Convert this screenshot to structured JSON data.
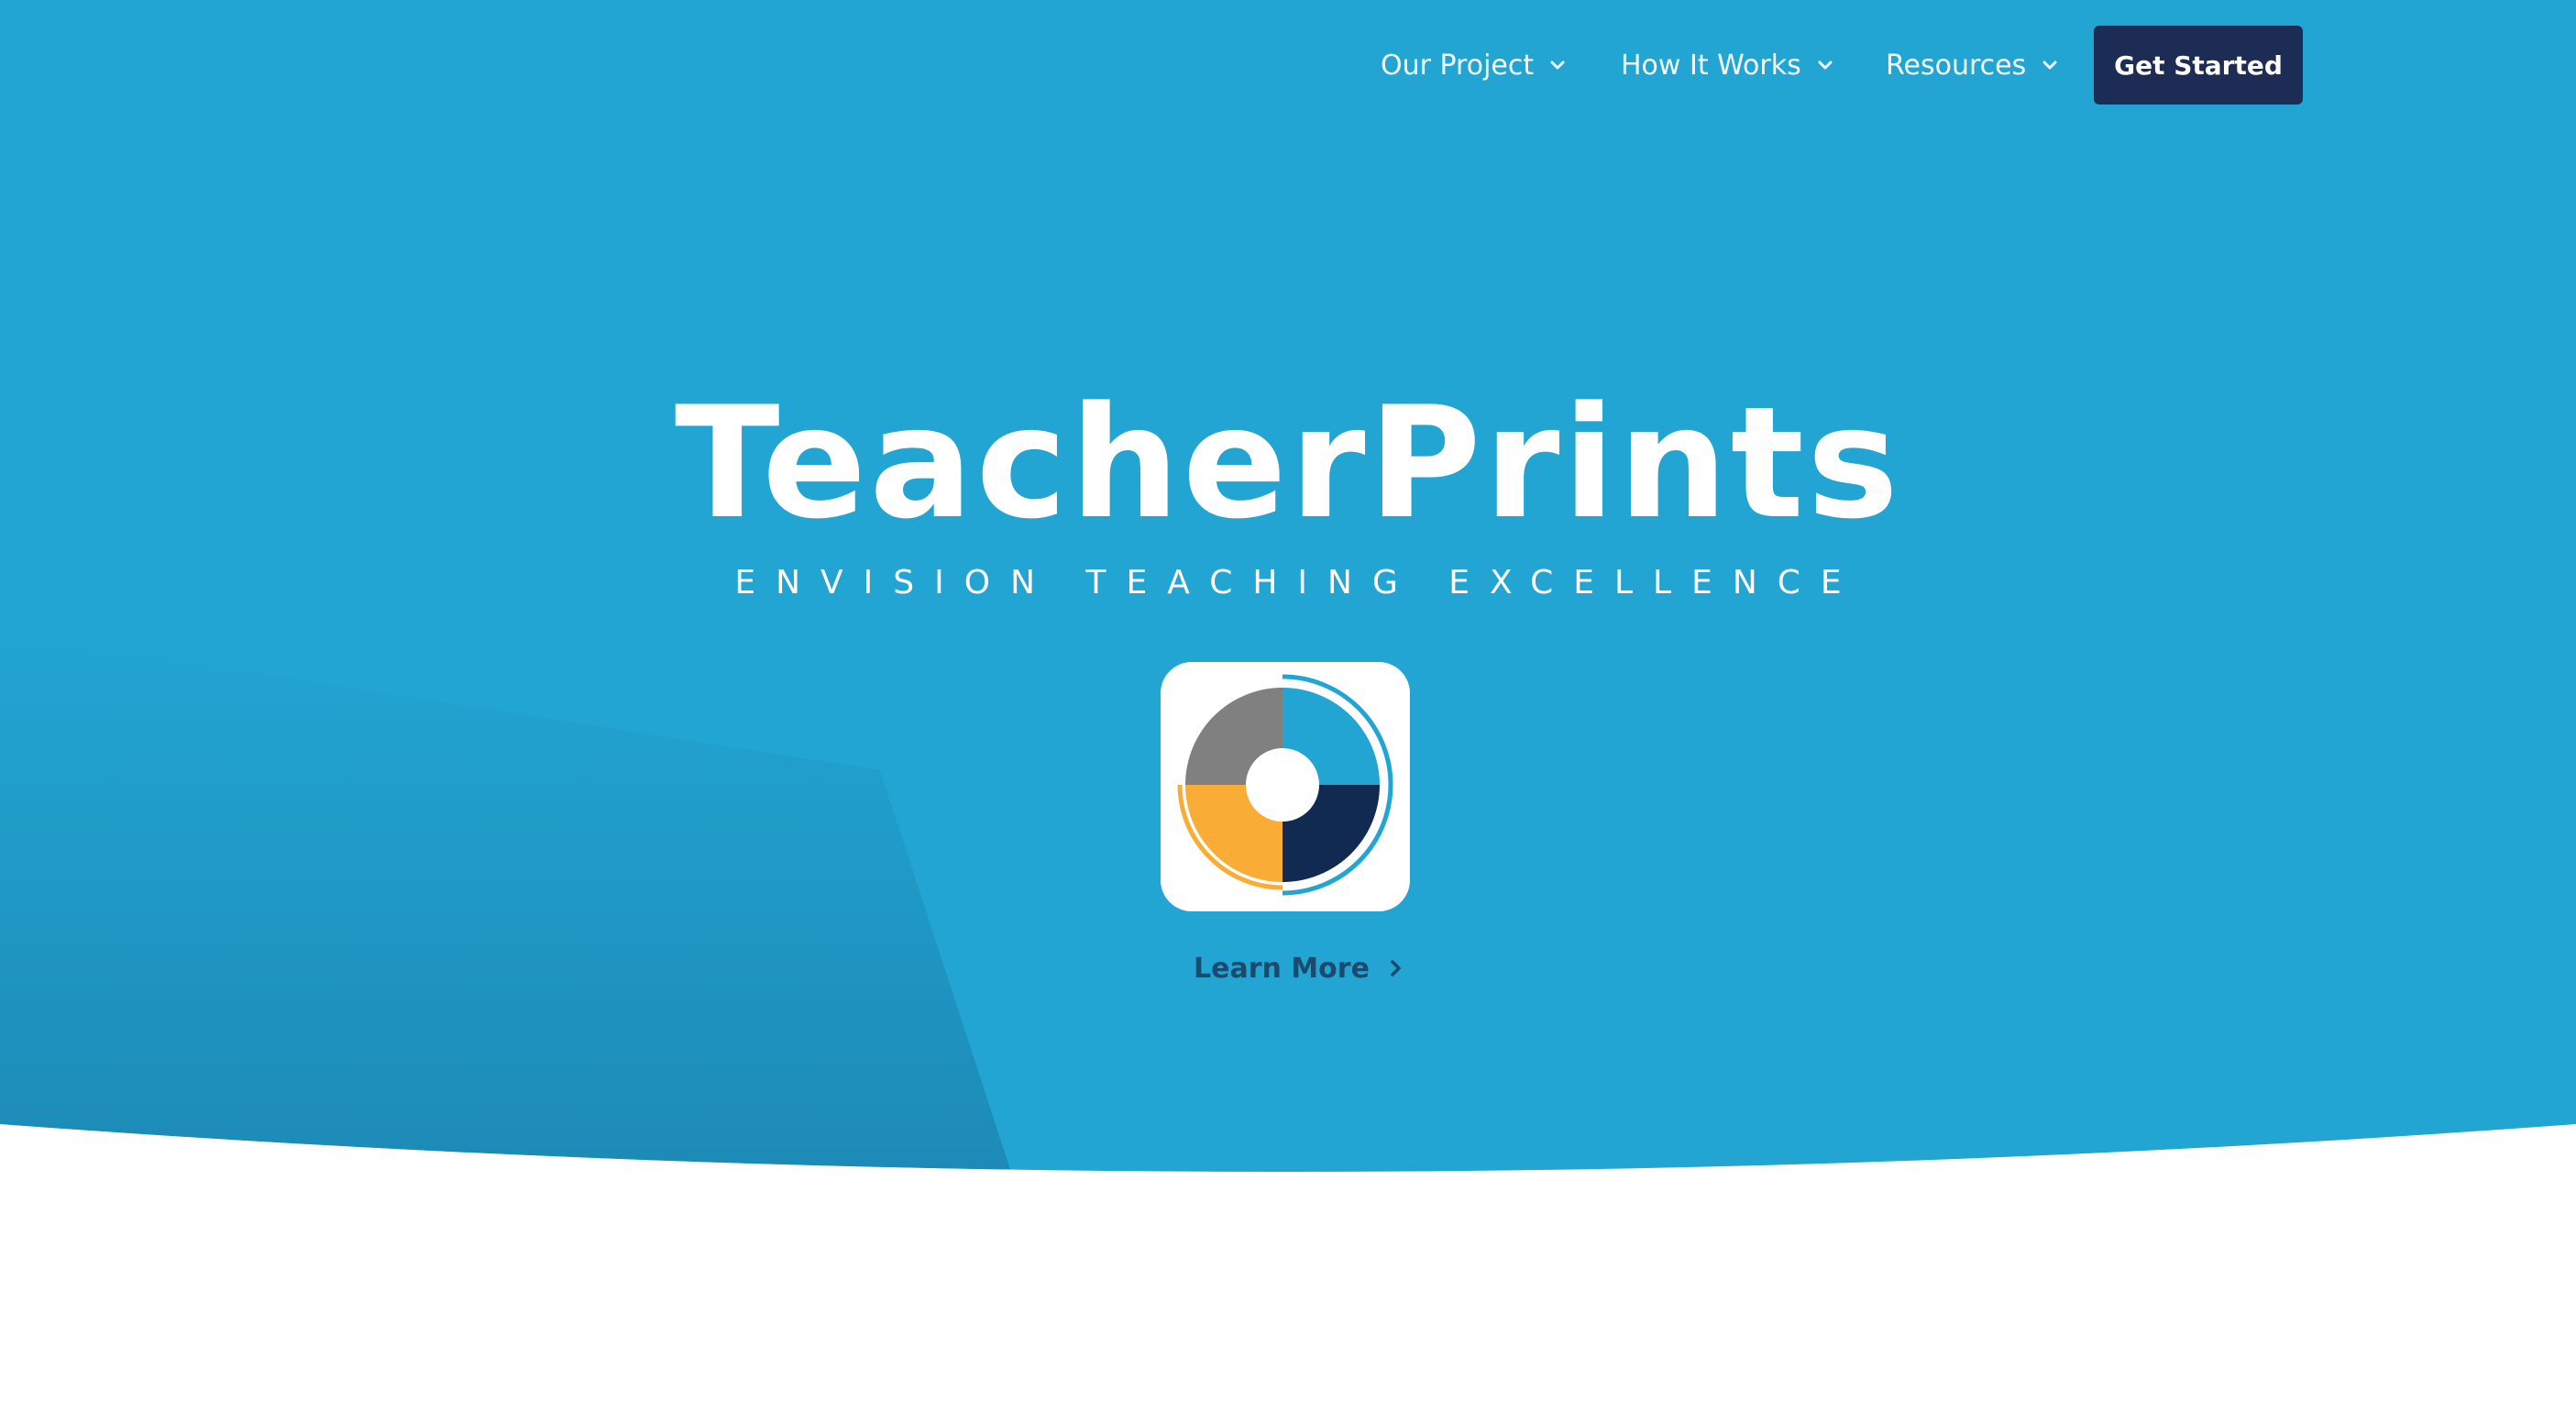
{
  "colors": {
    "hero_blue": "#22a5d3",
    "hero_shadow": "#1c86b2",
    "nav_button": "#1d2c55",
    "learn_more_text": "#1a4a6e",
    "logo_gray": "#808080",
    "logo_blue": "#22a5d3",
    "logo_orange": "#f9ad36",
    "logo_navy": "#102a52"
  },
  "nav": {
    "items": [
      {
        "label": "Our Project",
        "icon": "chevron-down-icon"
      },
      {
        "label": "How It Works",
        "icon": "chevron-down-icon"
      },
      {
        "label": "Resources",
        "icon": "chevron-down-icon"
      }
    ],
    "cta_label": "Get Started"
  },
  "hero": {
    "title": "TeacherPrints",
    "subtitle": "ENVISION TEACHING EXCELLENCE",
    "logo_icon": "teacherprints-logo-icon",
    "learn_more_label": "Learn More",
    "learn_more_icon": "chevron-right-icon"
  }
}
